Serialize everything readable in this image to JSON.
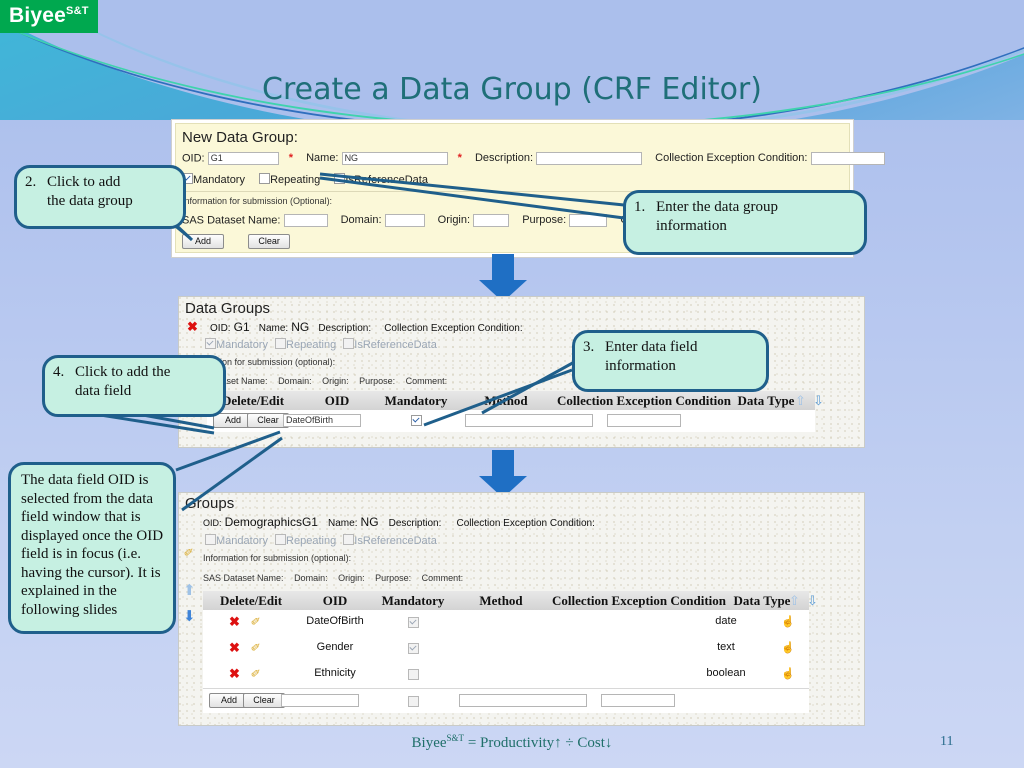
{
  "brand": {
    "name": "Biyee",
    "sup": "S&T"
  },
  "title": "Create a Data Group (CRF Editor)",
  "panel1": {
    "heading": "New Data Group:",
    "oid_label": "OID:",
    "oid_value": "G1",
    "name_label": "Name:",
    "name_value": "NG",
    "description_label": "Description:",
    "description_value": "",
    "cec_label": "Collection Exception Condition:",
    "cec_value": "",
    "required_mark": "*",
    "checkboxes": [
      {
        "label": "Mandatory",
        "checked": true
      },
      {
        "label": "Repeating",
        "checked": false
      },
      {
        "label": "IsReferenceData",
        "checked": false
      }
    ],
    "submission_label": "Information for submission (Optional):",
    "sas_label": "SAS Dataset Name:",
    "sas_value": "",
    "domain_label": "Domain:",
    "domain_value": "",
    "origin_label": "Origin:",
    "origin_value": "",
    "purpose_label": "Purpose:",
    "purpose_value": "",
    "comment_label": "Comment:",
    "comment_value": "",
    "add_label": "Add",
    "clear_label": "Clear"
  },
  "panel2": {
    "heading": "Data Groups",
    "oid_label": "OID:",
    "oid_value": "G1",
    "name_label": "Name:",
    "name_value": "NG",
    "description_label": "Description:",
    "cec_label": "Collection Exception Condition:",
    "checkboxes": [
      {
        "label": "Mandatory",
        "checked": true
      },
      {
        "label": "Repeating",
        "checked": false
      },
      {
        "label": "IsReferenceData",
        "checked": false
      }
    ],
    "submission_label": "Information for submission (optional):",
    "sas_label": "SAS Dataset Name:",
    "domain_label": "Domain:",
    "origin_label": "Origin:",
    "purpose_label": "Purpose:",
    "comment_label": "Comment:",
    "columns": [
      "Delete/Edit",
      "OID",
      "Mandatory",
      "Method",
      "Collection Exception Condition",
      "Data Type"
    ],
    "sort_up": "⇧",
    "sort_down": "⇩",
    "add_label": "Add",
    "clear_label": "Clear",
    "new_row": {
      "oid": "DateOfBirth",
      "mandatory": true,
      "method": "",
      "cec": ""
    }
  },
  "panel3": {
    "heading": "Groups",
    "oid_label": "OID:",
    "oid_value": "DemographicsG1",
    "name_label": "Name:",
    "name_value": "NG",
    "description_label": "Description:",
    "cec_label": "Collection Exception Condition:",
    "checkboxes": [
      {
        "label": "Mandatory",
        "checked": false
      },
      {
        "label": "Repeating",
        "checked": false
      },
      {
        "label": "IsReferenceData",
        "checked": false
      }
    ],
    "submission_label": "Information for submission (optional):",
    "sas_label": "SAS Dataset Name:",
    "domain_label": "Domain:",
    "origin_label": "Origin:",
    "purpose_label": "Purpose:",
    "comment_label": "Comment:",
    "columns": [
      "Delete/Edit",
      "OID",
      "Mandatory",
      "Method",
      "Collection Exception Condition",
      "Data Type"
    ],
    "sort_up": "⇧",
    "sort_down": "⇩",
    "rows": [
      {
        "oid": "DateOfBirth",
        "mandatory": true,
        "method": "",
        "cec": "",
        "datatype": "date"
      },
      {
        "oid": "Gender",
        "mandatory": true,
        "method": "",
        "cec": "",
        "datatype": "text"
      },
      {
        "oid": "Ethnicity",
        "mandatory": false,
        "method": "",
        "cec": "",
        "datatype": "boolean"
      }
    ],
    "add_label": "Add",
    "clear_label": "Clear",
    "new_row": {
      "oid": "",
      "mandatory": false,
      "method": "",
      "cec": ""
    }
  },
  "callouts": [
    {
      "num": "1.",
      "text": "Enter the data group\ninformation"
    },
    {
      "num": "2.",
      "text": "Click to add\nthe data group"
    },
    {
      "num": "3.",
      "text": "Enter data field\ninformation"
    },
    {
      "num": "4.",
      "text": "Click to add the\ndata field"
    }
  ],
  "note": "The data field OID is selected from the data field window that is displayed once the OID field is in focus (i.e. having the cursor). It is explained in the following slides",
  "footer": {
    "prefix": "Biyee",
    "sup": "S&T",
    "formula": " = Productivity↑ ÷ Cost↓"
  },
  "page_number": "11",
  "colors": {
    "accent_teal": "#1f6f78",
    "callout_fill": "#c6f0e2",
    "callout_border": "#1f5f8b",
    "arrow_blue": "#1f6fc4",
    "logo_green": "#00a84f",
    "form_yellow": "#fbf8d8",
    "required_red": "#e02020"
  }
}
